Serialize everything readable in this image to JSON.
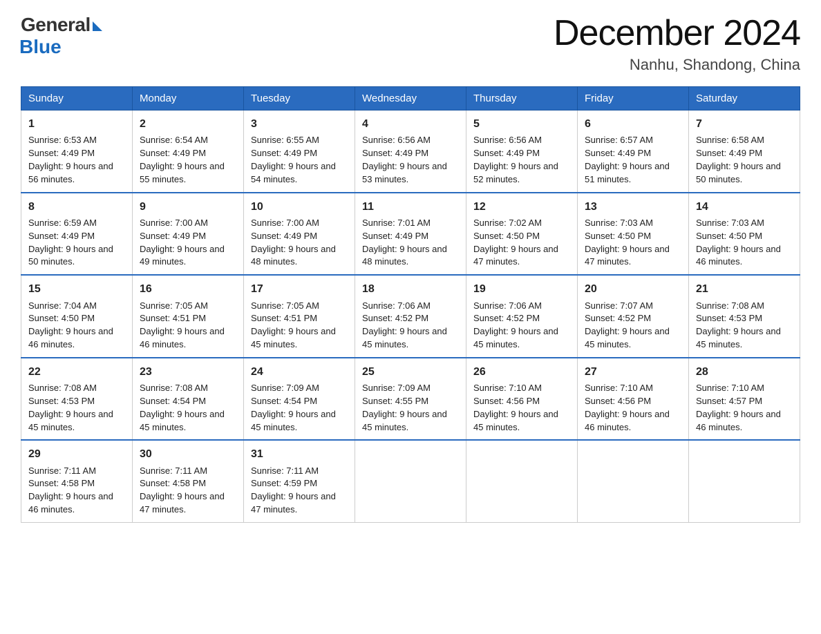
{
  "header": {
    "logo_general": "General",
    "logo_blue": "Blue",
    "month_title": "December 2024",
    "location": "Nanhu, Shandong, China"
  },
  "days_of_week": [
    "Sunday",
    "Monday",
    "Tuesday",
    "Wednesday",
    "Thursday",
    "Friday",
    "Saturday"
  ],
  "weeks": [
    [
      {
        "day": "1",
        "sunrise": "6:53 AM",
        "sunset": "4:49 PM",
        "daylight": "9 hours and 56 minutes."
      },
      {
        "day": "2",
        "sunrise": "6:54 AM",
        "sunset": "4:49 PM",
        "daylight": "9 hours and 55 minutes."
      },
      {
        "day": "3",
        "sunrise": "6:55 AM",
        "sunset": "4:49 PM",
        "daylight": "9 hours and 54 minutes."
      },
      {
        "day": "4",
        "sunrise": "6:56 AM",
        "sunset": "4:49 PM",
        "daylight": "9 hours and 53 minutes."
      },
      {
        "day": "5",
        "sunrise": "6:56 AM",
        "sunset": "4:49 PM",
        "daylight": "9 hours and 52 minutes."
      },
      {
        "day": "6",
        "sunrise": "6:57 AM",
        "sunset": "4:49 PM",
        "daylight": "9 hours and 51 minutes."
      },
      {
        "day": "7",
        "sunrise": "6:58 AM",
        "sunset": "4:49 PM",
        "daylight": "9 hours and 50 minutes."
      }
    ],
    [
      {
        "day": "8",
        "sunrise": "6:59 AM",
        "sunset": "4:49 PM",
        "daylight": "9 hours and 50 minutes."
      },
      {
        "day": "9",
        "sunrise": "7:00 AM",
        "sunset": "4:49 PM",
        "daylight": "9 hours and 49 minutes."
      },
      {
        "day": "10",
        "sunrise": "7:00 AM",
        "sunset": "4:49 PM",
        "daylight": "9 hours and 48 minutes."
      },
      {
        "day": "11",
        "sunrise": "7:01 AM",
        "sunset": "4:49 PM",
        "daylight": "9 hours and 48 minutes."
      },
      {
        "day": "12",
        "sunrise": "7:02 AM",
        "sunset": "4:50 PM",
        "daylight": "9 hours and 47 minutes."
      },
      {
        "day": "13",
        "sunrise": "7:03 AM",
        "sunset": "4:50 PM",
        "daylight": "9 hours and 47 minutes."
      },
      {
        "day": "14",
        "sunrise": "7:03 AM",
        "sunset": "4:50 PM",
        "daylight": "9 hours and 46 minutes."
      }
    ],
    [
      {
        "day": "15",
        "sunrise": "7:04 AM",
        "sunset": "4:50 PM",
        "daylight": "9 hours and 46 minutes."
      },
      {
        "day": "16",
        "sunrise": "7:05 AM",
        "sunset": "4:51 PM",
        "daylight": "9 hours and 46 minutes."
      },
      {
        "day": "17",
        "sunrise": "7:05 AM",
        "sunset": "4:51 PM",
        "daylight": "9 hours and 45 minutes."
      },
      {
        "day": "18",
        "sunrise": "7:06 AM",
        "sunset": "4:52 PM",
        "daylight": "9 hours and 45 minutes."
      },
      {
        "day": "19",
        "sunrise": "7:06 AM",
        "sunset": "4:52 PM",
        "daylight": "9 hours and 45 minutes."
      },
      {
        "day": "20",
        "sunrise": "7:07 AM",
        "sunset": "4:52 PM",
        "daylight": "9 hours and 45 minutes."
      },
      {
        "day": "21",
        "sunrise": "7:08 AM",
        "sunset": "4:53 PM",
        "daylight": "9 hours and 45 minutes."
      }
    ],
    [
      {
        "day": "22",
        "sunrise": "7:08 AM",
        "sunset": "4:53 PM",
        "daylight": "9 hours and 45 minutes."
      },
      {
        "day": "23",
        "sunrise": "7:08 AM",
        "sunset": "4:54 PM",
        "daylight": "9 hours and 45 minutes."
      },
      {
        "day": "24",
        "sunrise": "7:09 AM",
        "sunset": "4:54 PM",
        "daylight": "9 hours and 45 minutes."
      },
      {
        "day": "25",
        "sunrise": "7:09 AM",
        "sunset": "4:55 PM",
        "daylight": "9 hours and 45 minutes."
      },
      {
        "day": "26",
        "sunrise": "7:10 AM",
        "sunset": "4:56 PM",
        "daylight": "9 hours and 45 minutes."
      },
      {
        "day": "27",
        "sunrise": "7:10 AM",
        "sunset": "4:56 PM",
        "daylight": "9 hours and 46 minutes."
      },
      {
        "day": "28",
        "sunrise": "7:10 AM",
        "sunset": "4:57 PM",
        "daylight": "9 hours and 46 minutes."
      }
    ],
    [
      {
        "day": "29",
        "sunrise": "7:11 AM",
        "sunset": "4:58 PM",
        "daylight": "9 hours and 46 minutes."
      },
      {
        "day": "30",
        "sunrise": "7:11 AM",
        "sunset": "4:58 PM",
        "daylight": "9 hours and 47 minutes."
      },
      {
        "day": "31",
        "sunrise": "7:11 AM",
        "sunset": "4:59 PM",
        "daylight": "9 hours and 47 minutes."
      },
      null,
      null,
      null,
      null
    ]
  ]
}
